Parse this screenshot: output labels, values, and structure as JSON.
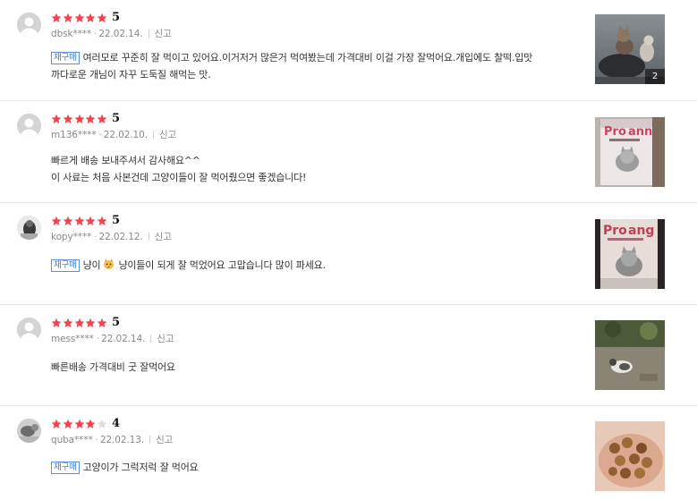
{
  "colors": {
    "star_filled": "#f5424f",
    "star_empty": "#dddddd",
    "badge_border": "#5c8fd6",
    "badge_text": "#3f7ac6",
    "meta_text": "#888888"
  },
  "badge_label": "재구매",
  "report_label": "신고",
  "reviews": [
    {
      "rating": 5,
      "score_text": "5",
      "user": "dbsk****",
      "date": "22.02.14.",
      "repurchase": true,
      "text_line1": "여러모로 꾸준히 잘 먹이고 있어요.이거저거 많은거 먹여봤는데 가격대비 이걸 가장 잘먹어요.개입에도 찰떡.입맛",
      "text_line2": "까다로운 개님이 자꾸 도둑질 해먹는 맛.",
      "photo_count": "2",
      "avatar_icon": "default-user-icon"
    },
    {
      "rating": 5,
      "score_text": "5",
      "user": "m136****",
      "date": "22.02.10.",
      "repurchase": false,
      "text_line1": "빠르게 배송 보내주셔서 감사해요^^",
      "text_line2": "이 사료는 처음 사본건데 고양이들이 잘 먹어줬으면 좋겠습니다!",
      "avatar_icon": "default-user-icon"
    },
    {
      "rating": 5,
      "score_text": "5",
      "user": "kopy****",
      "date": "22.02.12.",
      "repurchase": true,
      "text_before_emoji": "냥이",
      "text_after_emoji": "냥이들이 되게 잘 먹었어요 고맙습니다 많이 파세요.",
      "emoji_icon": "cat-emoji-icon",
      "avatar_icon": "profile-photo-icon"
    },
    {
      "rating": 5,
      "score_text": "5",
      "user": "mess****",
      "date": "22.02.14.",
      "repurchase": false,
      "text_line1": "빠른배송 가격대비 굿  잘먹어요",
      "avatar_icon": "default-user-icon"
    },
    {
      "rating": 4,
      "score_text": "4",
      "user": "quba****",
      "date": "22.02.13.",
      "repurchase": true,
      "text_line1": "고양이가 그럭저럭 잘 먹어요",
      "avatar_icon": "profile-photo-icon"
    }
  ]
}
